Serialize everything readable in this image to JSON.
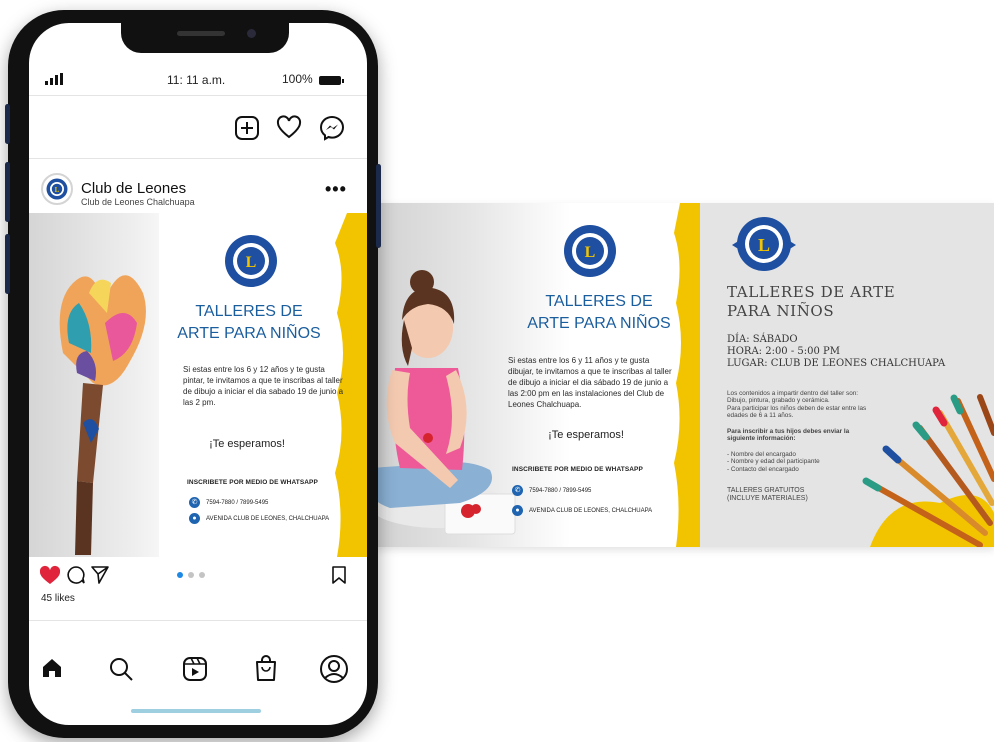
{
  "status_bar": {
    "time": "11: 11 a.m.",
    "battery": "100%"
  },
  "post_header": {
    "account_name": "Club de Leones",
    "account_subtitle": "Club de Leones Chalchuapa"
  },
  "flyer": {
    "title_line1": "TALLERES DE",
    "title_line2": "ARTE PARA NIÑOS",
    "body_a": "Si estas entre los 6 y 12 años y te gusta pintar, te invitamos a que te inscribas al taller de dibujo a iniciar el dia sabado 19 de junio a las 2 pm.",
    "body_b": "Si estas entre los 6 y 11 años y te gusta dibujar, te invitamos a que te inscribas al taller de dibujo a iniciar el dia sábado 19 de junio a las 2:00 pm en las instalaciones del Club de Leones Chalchuapa.",
    "wait": "¡Te esperamos!",
    "inscribe": "INSCRIBETE POR MEDIO DE WHATSAPP",
    "phones": "7594-7880 / 7899-5495",
    "phones_b": "7594-7880 / 7899-5495",
    "address": "AVENIDA CLUB DE LEONES, CHALCHUAPA"
  },
  "slide3": {
    "title_line1": "TALLERES DE ARTE",
    "title_line2": "PARA NIÑOS",
    "day": "DÍA: SÁBADO",
    "hour": "HORA: 2:00 - 5:00 PM",
    "place": "LUGAR: CLUB DE LEONES CHALCHUAPA",
    "contents_1": "Los contenidos a impartir dentro del taller son:",
    "contents_2": "Dibujo, pintura, grabado y cerámica.",
    "contents_3": "Para participar los niños deben de estar entre las",
    "contents_4": "edades de 6 a 11 años.",
    "inscribe_1": "Para inscribir a tus hijos debes enviar la",
    "inscribe_2": "siguiente información:",
    "item_1": "- Nombre del encargado",
    "item_2": "- Nombre y edad del participante",
    "item_3": "- Contacto del encargado",
    "free_1": "TALLERES GRATUITOS",
    "free_2": "(INCLUYE MATERIALES)"
  },
  "engagement": {
    "likes": "45 likes",
    "carousel_dots": 3,
    "active_dot": 1
  },
  "colors": {
    "brand_blue": "#1b5e9e",
    "accent_yellow": "#f2c400",
    "like_red": "#e0243b"
  }
}
